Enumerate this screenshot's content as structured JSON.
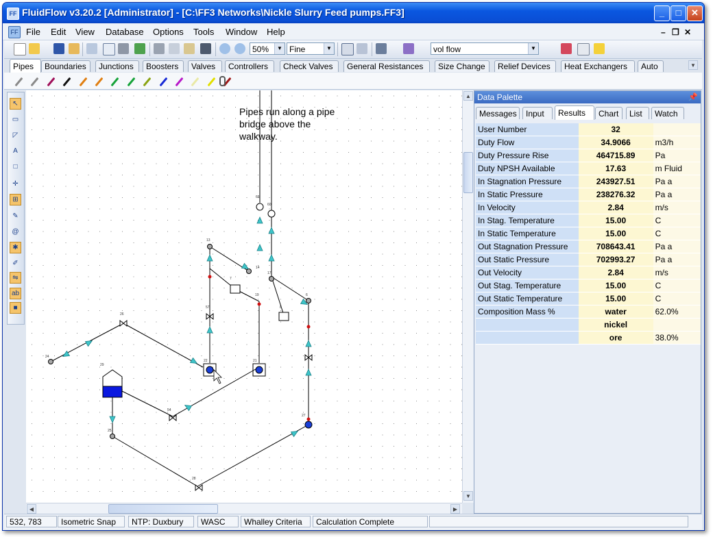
{
  "window": {
    "title": "FluidFlow v3.20.2 [Administrator] - [C:\\FF3 Networks\\Nickle Slurry Feed pumps.FF3]"
  },
  "menu": [
    "File",
    "Edit",
    "View",
    "Database",
    "Options",
    "Tools",
    "Window",
    "Help"
  ],
  "toolbar": {
    "zoom": "50%",
    "mesh": "Fine",
    "display": "vol flow"
  },
  "component_tabs": [
    "Pipes",
    "Boundaries",
    "Junctions",
    "Boosters",
    "Valves",
    "Controllers",
    "Check Valves",
    "General Resistances",
    "Size Change",
    "Relief Devices",
    "Heat Exchangers",
    "Auto"
  ],
  "pipe_colors": [
    "#8a8a8a",
    "#8a8a8a",
    "#a0105a",
    "#111111",
    "#e07f12",
    "#e07f12",
    "#17a33a",
    "#17a33a",
    "#8aa313",
    "#1a2cd6",
    "#b81ac9",
    "#e9e9a6",
    "#e2e000",
    "#a01818"
  ],
  "canvas": {
    "annotation": "Pipes run along a pipe\nbridge above the\nwalkway.",
    "node_labels": [
      "66",
      "60",
      "13",
      "14",
      "17",
      "7",
      "19",
      "6",
      "8",
      "57",
      "26",
      "24",
      "29",
      "22",
      "21",
      "27",
      "54",
      "25",
      "28"
    ]
  },
  "palette": {
    "title": "Data Palette",
    "pin_icon": "pin-icon",
    "tabs": [
      "Messages",
      "Input",
      "Results",
      "Chart",
      "List",
      "Watch"
    ],
    "active_tab": "Results",
    "rows": [
      {
        "label": "User Number",
        "value": "32",
        "unit": ""
      },
      {
        "label": "Duty Flow",
        "value": "34.9066",
        "unit": "m3/h"
      },
      {
        "label": "Duty Pressure Rise",
        "value": "464715.89",
        "unit": "Pa"
      },
      {
        "label": "Duty NPSH Available",
        "value": "17.63",
        "unit": "m Fluid"
      },
      {
        "label": "In Stagnation Pressure",
        "value": "243927.51",
        "unit": "Pa a"
      },
      {
        "label": "In Static Pressure",
        "value": "238276.32",
        "unit": "Pa a"
      },
      {
        "label": "In Velocity",
        "value": "2.84",
        "unit": "m/s"
      },
      {
        "label": "In Stag. Temperature",
        "value": "15.00",
        "unit": "C"
      },
      {
        "label": "In Static Temperature",
        "value": "15.00",
        "unit": "C"
      },
      {
        "label": "Out Stagnation Pressure",
        "value": "708643.41",
        "unit": "Pa a"
      },
      {
        "label": "Out Static Pressure",
        "value": "702993.27",
        "unit": "Pa a"
      },
      {
        "label": "Out Velocity",
        "value": "2.84",
        "unit": "m/s"
      },
      {
        "label": "Out Stag. Temperature",
        "value": "15.00",
        "unit": "C"
      },
      {
        "label": "Out Static Temperature",
        "value": "15.00",
        "unit": "C"
      },
      {
        "label": "Composition Mass %",
        "value": "water",
        "unit": "62.0%"
      },
      {
        "label": "",
        "value": "nickel",
        "unit": ""
      },
      {
        "label": "",
        "value": "ore",
        "unit": "38.0%"
      }
    ]
  },
  "status": [
    "532, 783",
    "Isometric Snap",
    "NTP: Duxbury",
    "WASC",
    "Whalley Criteria",
    "Calculation Complete"
  ]
}
